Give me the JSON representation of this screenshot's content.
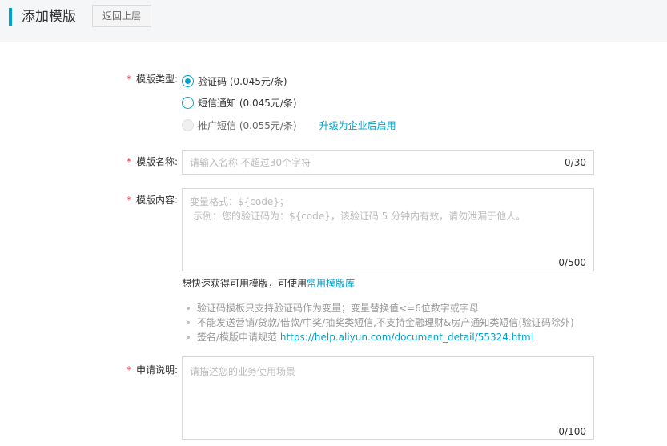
{
  "header": {
    "title": "添加模版",
    "back_label": "返回上层"
  },
  "form": {
    "required_mark": "*",
    "type": {
      "label": "模版类型:",
      "options": [
        {
          "label": "验证码 (0.045元/条)",
          "state": "selected"
        },
        {
          "label": "短信通知 (0.045元/条)",
          "state": "unselected"
        },
        {
          "label": "推广短信 (0.055元/条)",
          "state": "disabled"
        }
      ],
      "upgrade_link": "升级为企业后启用"
    },
    "name": {
      "label": "模版名称:",
      "placeholder": "请输入名称 不超过30个字符",
      "counter": "0/30"
    },
    "content": {
      "label": "模版内容:",
      "placeholder_line1": "变量格式：${code}；",
      "placeholder_line2": "示例：您的验证码为：${code}，该验证码 5 分钟内有效，请勿泄漏于他人。",
      "counter": "0/500",
      "hint_text": "想快速获得可用模版，可使用",
      "hint_link": "常用模版库",
      "tips": [
        "验证码模板只支持验证码作为变量；变量替换值<=6位数字或字母",
        "不能发送营销/贷款/借款/中奖/抽奖类短信,不支持金融理财&房产通知类短信(验证码除外)"
      ],
      "tip3_prefix": "签名/模版申请规范 ",
      "tip3_link": "https://help.aliyun.com/document_detail/55324.html"
    },
    "remark": {
      "label": "申请说明:",
      "placeholder": "请描述您的业务使用场景",
      "counter": "0/100"
    }
  },
  "colors": {
    "accent": "#00a2ca",
    "required": "#e4393c"
  }
}
